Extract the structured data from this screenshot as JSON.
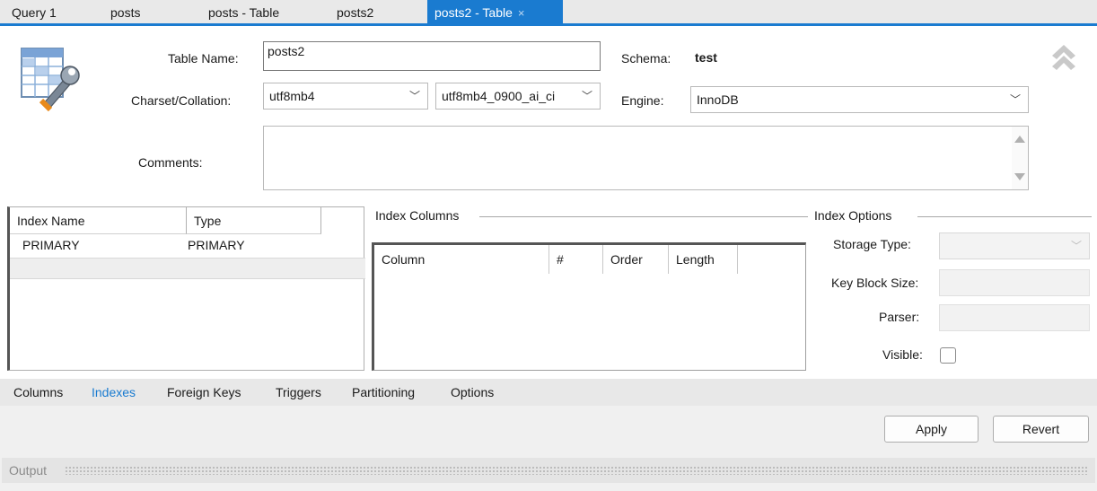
{
  "tabs": [
    {
      "label": "Query 1"
    },
    {
      "label": "posts"
    },
    {
      "label": "posts - Table"
    },
    {
      "label": "posts2"
    },
    {
      "label": "posts2 - Table",
      "close": "×"
    }
  ],
  "form": {
    "table_name_label": "Table Name:",
    "table_name_value": "posts2",
    "schema_label": "Schema:",
    "schema_value": "test",
    "charset_label": "Charset/Collation:",
    "charset_value": "utf8mb4",
    "collation_value": "utf8mb4_0900_ai_ci",
    "engine_label": "Engine:",
    "engine_value": "InnoDB",
    "comments_label": "Comments:",
    "comments_value": ""
  },
  "index_list": {
    "headers": [
      "Index Name",
      "Type"
    ],
    "rows": [
      {
        "name": "PRIMARY",
        "type": "PRIMARY"
      }
    ]
  },
  "index_columns": {
    "title": "Index Columns",
    "headers": [
      "Column",
      "#",
      "Order",
      "Length"
    ]
  },
  "index_options": {
    "title": "Index Options",
    "storage_type_label": "Storage Type:",
    "storage_type_value": "",
    "key_block_size_label": "Key Block Size:",
    "key_block_size_value": "",
    "parser_label": "Parser:",
    "parser_value": "",
    "visible_label": "Visible:",
    "visible_checked": false
  },
  "bottom_tabs": [
    {
      "label": "Columns"
    },
    {
      "label": "Indexes",
      "active": true
    },
    {
      "label": "Foreign Keys"
    },
    {
      "label": "Triggers"
    },
    {
      "label": "Partitioning"
    },
    {
      "label": "Options"
    }
  ],
  "buttons": {
    "apply": "Apply",
    "revert": "Revert"
  },
  "output": {
    "label": "Output"
  },
  "colors": {
    "accent": "#1a7bd0",
    "tab_bar": "#e9e9e9",
    "footer": "#f0f0f0"
  },
  "icons": {
    "table_editor": "table-wrench-icon",
    "collapse": "double-chevron-up-icon",
    "dropdown": "chevron-down-icon"
  }
}
